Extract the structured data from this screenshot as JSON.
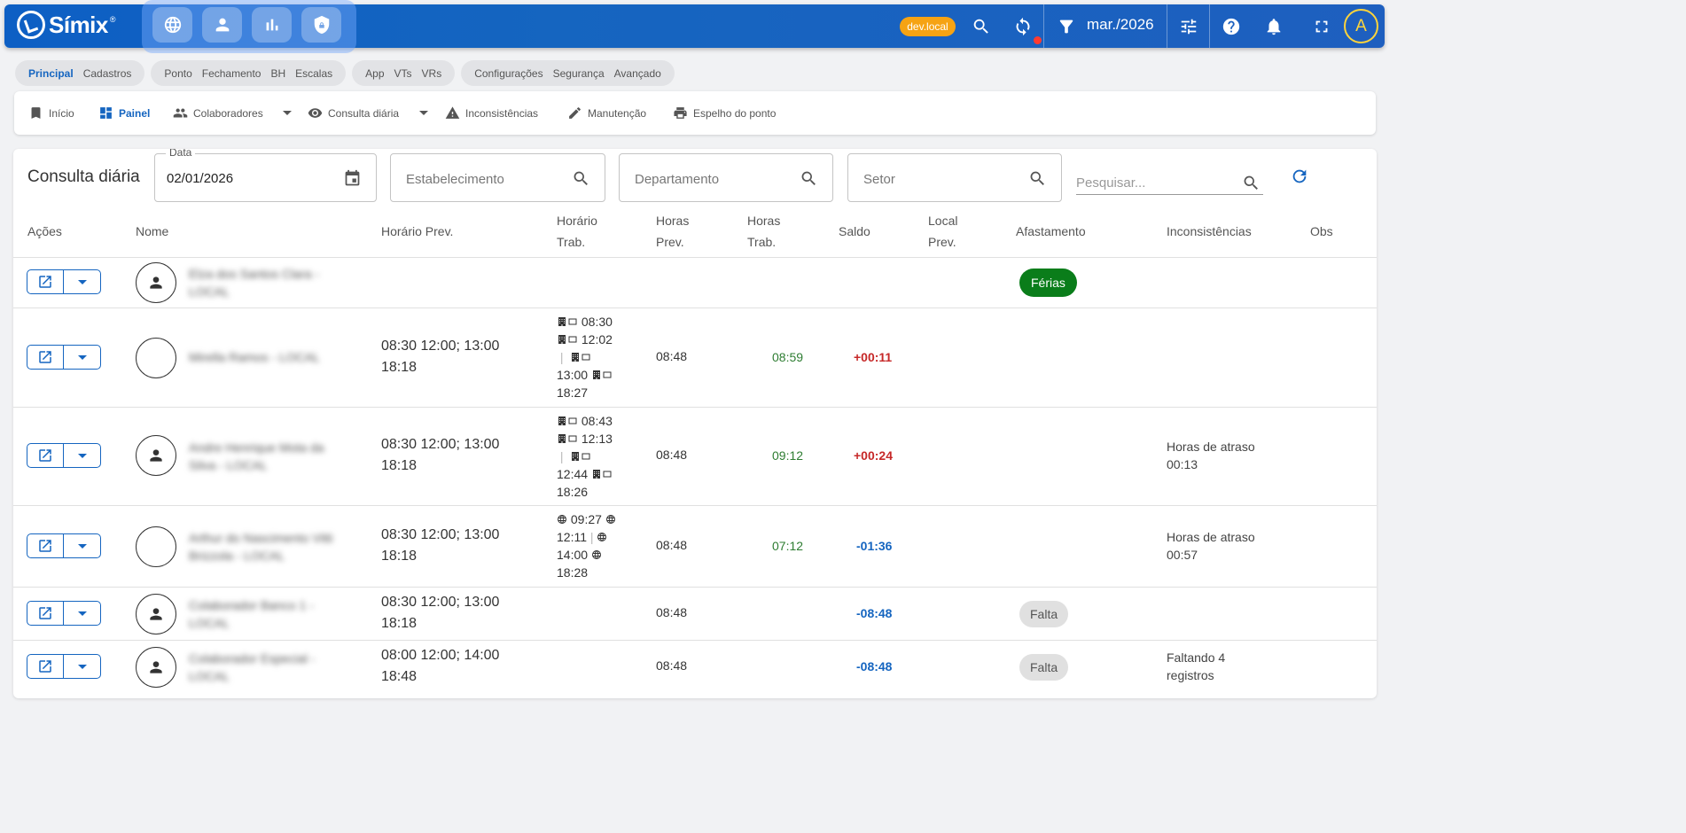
{
  "topbar": {
    "brand": "Símix",
    "brand_mark": "®",
    "quick_icons": [
      "globe-icon",
      "person-icon",
      "bar-chart-icon",
      "security-icon"
    ],
    "env_badge": "dev.local",
    "period": "mar./2026",
    "user_initial": "A",
    "colors": {
      "bar": "#1565c0",
      "env_badge": "#f6a313",
      "avatar": "#ffd43b",
      "notification_dot": "#ff3b30"
    }
  },
  "groups": [
    {
      "items": [
        "Principal",
        "Cadastros"
      ],
      "active": "Principal"
    },
    {
      "items": [
        "Ponto",
        "Fechamento",
        "BH",
        "Escalas"
      ]
    },
    {
      "items": [
        "App",
        "VTs",
        "VRs"
      ]
    },
    {
      "items": [
        "Configurações",
        "Segurança",
        "Avançado"
      ]
    }
  ],
  "nav": {
    "inicio": "Início",
    "painel": "Painel",
    "colaboradores": "Colaboradores",
    "consulta": "Consulta diária",
    "inconsistencias": "Inconsistências",
    "manutencao": "Manutenção",
    "espelho": "Espelho do ponto"
  },
  "page": {
    "title": "Consulta diária",
    "date_label": "Data",
    "date_value": "02/01/2026",
    "estabelecimento_ph": "Estabelecimento",
    "departamento_ph": "Departamento",
    "setor_ph": "Setor",
    "search_ph": "Pesquisar..."
  },
  "table": {
    "headers": {
      "acoes": "Ações",
      "nome": "Nome",
      "horario_prev": "Horário Prev.",
      "horario_trab_1": "Horário",
      "horario_trab_2": "Trab.",
      "horas_prev_1": "Horas",
      "horas_prev_2": "Prev.",
      "horas_trab_1": "Horas",
      "horas_trab_2": "Trab.",
      "saldo": "Saldo",
      "local_prev_1": "Local",
      "local_prev_2": "Prev.",
      "afastamento": "Afastamento",
      "inconsistencias": "Inconsistências",
      "obs": "Obs"
    },
    "rows": [
      {
        "name_1": "Elza dos Santos Clara -",
        "name_2": "LOCAL",
        "horario_prev_1": "",
        "horario_prev_2": "",
        "horas_prev": "",
        "horas_trab": "",
        "saldo": "",
        "afastamento": "Férias",
        "incons_1": "",
        "incons_2": ""
      },
      {
        "name_1": "Mirella Ramos - LOCAL",
        "name_2": "",
        "horario_prev_1": "08:30 12:00; 13:00",
        "horario_prev_2": "18:18",
        "trab": [
          "08:30",
          "12:02",
          "13:00",
          "18:27"
        ],
        "horas_prev": "08:48",
        "horas_trab": "08:59",
        "saldo": "+00:11",
        "afastamento": "",
        "incons_1": "",
        "incons_2": ""
      },
      {
        "name_1": "Andre Henrique Mota da",
        "name_2": "Silva - LOCAL",
        "horario_prev_1": "08:30 12:00; 13:00",
        "horario_prev_2": "18:18",
        "trab": [
          "08:43",
          "12:13",
          "12:44",
          "18:26"
        ],
        "horas_prev": "08:48",
        "horas_trab": "09:12",
        "saldo": "+00:24",
        "afastamento": "",
        "incons_1": "Horas de atraso",
        "incons_2": "00:13"
      },
      {
        "name_1": "Arthur do Nascimento Vitti",
        "name_2": "Brizzola - LOCAL",
        "horario_prev_1": "08:30 12:00; 13:00",
        "horario_prev_2": "18:18",
        "trab": [
          "09:27",
          "12:11",
          "14:00",
          "18:28"
        ],
        "horas_prev": "08:48",
        "horas_trab": "07:12",
        "saldo": "-01:36",
        "afastamento": "",
        "incons_1": "Horas de atraso",
        "incons_2": "00:57"
      },
      {
        "name_1": "Colaborador Banco 1 -",
        "name_2": "LOCAL",
        "horario_prev_1": "08:30 12:00; 13:00",
        "horario_prev_2": "18:18",
        "horas_prev": "08:48",
        "horas_trab": "",
        "saldo": "-08:48",
        "afastamento": "Falta",
        "incons_1": "",
        "incons_2": ""
      },
      {
        "name_1": "Colaborador Especial -",
        "name_2": "LOCAL",
        "horario_prev_1": "08:00 12:00; 14:00",
        "horario_prev_2": "18:48",
        "horas_prev": "08:48",
        "horas_trab": "",
        "saldo": "-08:48",
        "afastamento": "Falta",
        "incons_1": "Faltando 4",
        "incons_2": "registros"
      }
    ]
  }
}
